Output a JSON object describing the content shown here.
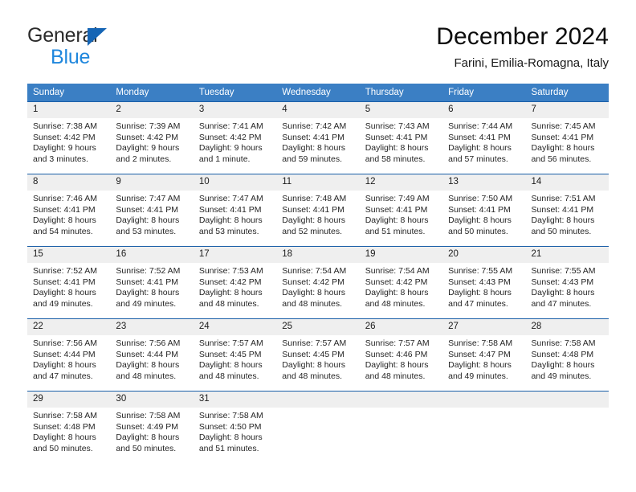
{
  "brand": {
    "name_part1": "General",
    "name_part2": "Blue",
    "triangle_color": "#1565b5",
    "blue_color": "#1f87dd"
  },
  "header": {
    "title": "December 2024",
    "subtitle": "Farini, Emilia-Romagna, Italy"
  },
  "theme": {
    "header_bg": "#3b7fc4",
    "row_border": "#1a5fa8",
    "daynum_bg": "#efefef"
  },
  "weekdays": [
    "Sunday",
    "Monday",
    "Tuesday",
    "Wednesday",
    "Thursday",
    "Friday",
    "Saturday"
  ],
  "weeks": [
    [
      {
        "day": "1",
        "sunrise": "Sunrise: 7:38 AM",
        "sunset": "Sunset: 4:42 PM",
        "daylight1": "Daylight: 9 hours",
        "daylight2": "and 3 minutes."
      },
      {
        "day": "2",
        "sunrise": "Sunrise: 7:39 AM",
        "sunset": "Sunset: 4:42 PM",
        "daylight1": "Daylight: 9 hours",
        "daylight2": "and 2 minutes."
      },
      {
        "day": "3",
        "sunrise": "Sunrise: 7:41 AM",
        "sunset": "Sunset: 4:42 PM",
        "daylight1": "Daylight: 9 hours",
        "daylight2": "and 1 minute."
      },
      {
        "day": "4",
        "sunrise": "Sunrise: 7:42 AM",
        "sunset": "Sunset: 4:41 PM",
        "daylight1": "Daylight: 8 hours",
        "daylight2": "and 59 minutes."
      },
      {
        "day": "5",
        "sunrise": "Sunrise: 7:43 AM",
        "sunset": "Sunset: 4:41 PM",
        "daylight1": "Daylight: 8 hours",
        "daylight2": "and 58 minutes."
      },
      {
        "day": "6",
        "sunrise": "Sunrise: 7:44 AM",
        "sunset": "Sunset: 4:41 PM",
        "daylight1": "Daylight: 8 hours",
        "daylight2": "and 57 minutes."
      },
      {
        "day": "7",
        "sunrise": "Sunrise: 7:45 AM",
        "sunset": "Sunset: 4:41 PM",
        "daylight1": "Daylight: 8 hours",
        "daylight2": "and 56 minutes."
      }
    ],
    [
      {
        "day": "8",
        "sunrise": "Sunrise: 7:46 AM",
        "sunset": "Sunset: 4:41 PM",
        "daylight1": "Daylight: 8 hours",
        "daylight2": "and 54 minutes."
      },
      {
        "day": "9",
        "sunrise": "Sunrise: 7:47 AM",
        "sunset": "Sunset: 4:41 PM",
        "daylight1": "Daylight: 8 hours",
        "daylight2": "and 53 minutes."
      },
      {
        "day": "10",
        "sunrise": "Sunrise: 7:47 AM",
        "sunset": "Sunset: 4:41 PM",
        "daylight1": "Daylight: 8 hours",
        "daylight2": "and 53 minutes."
      },
      {
        "day": "11",
        "sunrise": "Sunrise: 7:48 AM",
        "sunset": "Sunset: 4:41 PM",
        "daylight1": "Daylight: 8 hours",
        "daylight2": "and 52 minutes."
      },
      {
        "day": "12",
        "sunrise": "Sunrise: 7:49 AM",
        "sunset": "Sunset: 4:41 PM",
        "daylight1": "Daylight: 8 hours",
        "daylight2": "and 51 minutes."
      },
      {
        "day": "13",
        "sunrise": "Sunrise: 7:50 AM",
        "sunset": "Sunset: 4:41 PM",
        "daylight1": "Daylight: 8 hours",
        "daylight2": "and 50 minutes."
      },
      {
        "day": "14",
        "sunrise": "Sunrise: 7:51 AM",
        "sunset": "Sunset: 4:41 PM",
        "daylight1": "Daylight: 8 hours",
        "daylight2": "and 50 minutes."
      }
    ],
    [
      {
        "day": "15",
        "sunrise": "Sunrise: 7:52 AM",
        "sunset": "Sunset: 4:41 PM",
        "daylight1": "Daylight: 8 hours",
        "daylight2": "and 49 minutes."
      },
      {
        "day": "16",
        "sunrise": "Sunrise: 7:52 AM",
        "sunset": "Sunset: 4:41 PM",
        "daylight1": "Daylight: 8 hours",
        "daylight2": "and 49 minutes."
      },
      {
        "day": "17",
        "sunrise": "Sunrise: 7:53 AM",
        "sunset": "Sunset: 4:42 PM",
        "daylight1": "Daylight: 8 hours",
        "daylight2": "and 48 minutes."
      },
      {
        "day": "18",
        "sunrise": "Sunrise: 7:54 AM",
        "sunset": "Sunset: 4:42 PM",
        "daylight1": "Daylight: 8 hours",
        "daylight2": "and 48 minutes."
      },
      {
        "day": "19",
        "sunrise": "Sunrise: 7:54 AM",
        "sunset": "Sunset: 4:42 PM",
        "daylight1": "Daylight: 8 hours",
        "daylight2": "and 48 minutes."
      },
      {
        "day": "20",
        "sunrise": "Sunrise: 7:55 AM",
        "sunset": "Sunset: 4:43 PM",
        "daylight1": "Daylight: 8 hours",
        "daylight2": "and 47 minutes."
      },
      {
        "day": "21",
        "sunrise": "Sunrise: 7:55 AM",
        "sunset": "Sunset: 4:43 PM",
        "daylight1": "Daylight: 8 hours",
        "daylight2": "and 47 minutes."
      }
    ],
    [
      {
        "day": "22",
        "sunrise": "Sunrise: 7:56 AM",
        "sunset": "Sunset: 4:44 PM",
        "daylight1": "Daylight: 8 hours",
        "daylight2": "and 47 minutes."
      },
      {
        "day": "23",
        "sunrise": "Sunrise: 7:56 AM",
        "sunset": "Sunset: 4:44 PM",
        "daylight1": "Daylight: 8 hours",
        "daylight2": "and 48 minutes."
      },
      {
        "day": "24",
        "sunrise": "Sunrise: 7:57 AM",
        "sunset": "Sunset: 4:45 PM",
        "daylight1": "Daylight: 8 hours",
        "daylight2": "and 48 minutes."
      },
      {
        "day": "25",
        "sunrise": "Sunrise: 7:57 AM",
        "sunset": "Sunset: 4:45 PM",
        "daylight1": "Daylight: 8 hours",
        "daylight2": "and 48 minutes."
      },
      {
        "day": "26",
        "sunrise": "Sunrise: 7:57 AM",
        "sunset": "Sunset: 4:46 PM",
        "daylight1": "Daylight: 8 hours",
        "daylight2": "and 48 minutes."
      },
      {
        "day": "27",
        "sunrise": "Sunrise: 7:58 AM",
        "sunset": "Sunset: 4:47 PM",
        "daylight1": "Daylight: 8 hours",
        "daylight2": "and 49 minutes."
      },
      {
        "day": "28",
        "sunrise": "Sunrise: 7:58 AM",
        "sunset": "Sunset: 4:48 PM",
        "daylight1": "Daylight: 8 hours",
        "daylight2": "and 49 minutes."
      }
    ],
    [
      {
        "day": "29",
        "sunrise": "Sunrise: 7:58 AM",
        "sunset": "Sunset: 4:48 PM",
        "daylight1": "Daylight: 8 hours",
        "daylight2": "and 50 minutes."
      },
      {
        "day": "30",
        "sunrise": "Sunrise: 7:58 AM",
        "sunset": "Sunset: 4:49 PM",
        "daylight1": "Daylight: 8 hours",
        "daylight2": "and 50 minutes."
      },
      {
        "day": "31",
        "sunrise": "Sunrise: 7:58 AM",
        "sunset": "Sunset: 4:50 PM",
        "daylight1": "Daylight: 8 hours",
        "daylight2": "and 51 minutes."
      },
      {
        "day": "",
        "sunrise": "",
        "sunset": "",
        "daylight1": "",
        "daylight2": ""
      },
      {
        "day": "",
        "sunrise": "",
        "sunset": "",
        "daylight1": "",
        "daylight2": ""
      },
      {
        "day": "",
        "sunrise": "",
        "sunset": "",
        "daylight1": "",
        "daylight2": ""
      },
      {
        "day": "",
        "sunrise": "",
        "sunset": "",
        "daylight1": "",
        "daylight2": ""
      }
    ]
  ]
}
